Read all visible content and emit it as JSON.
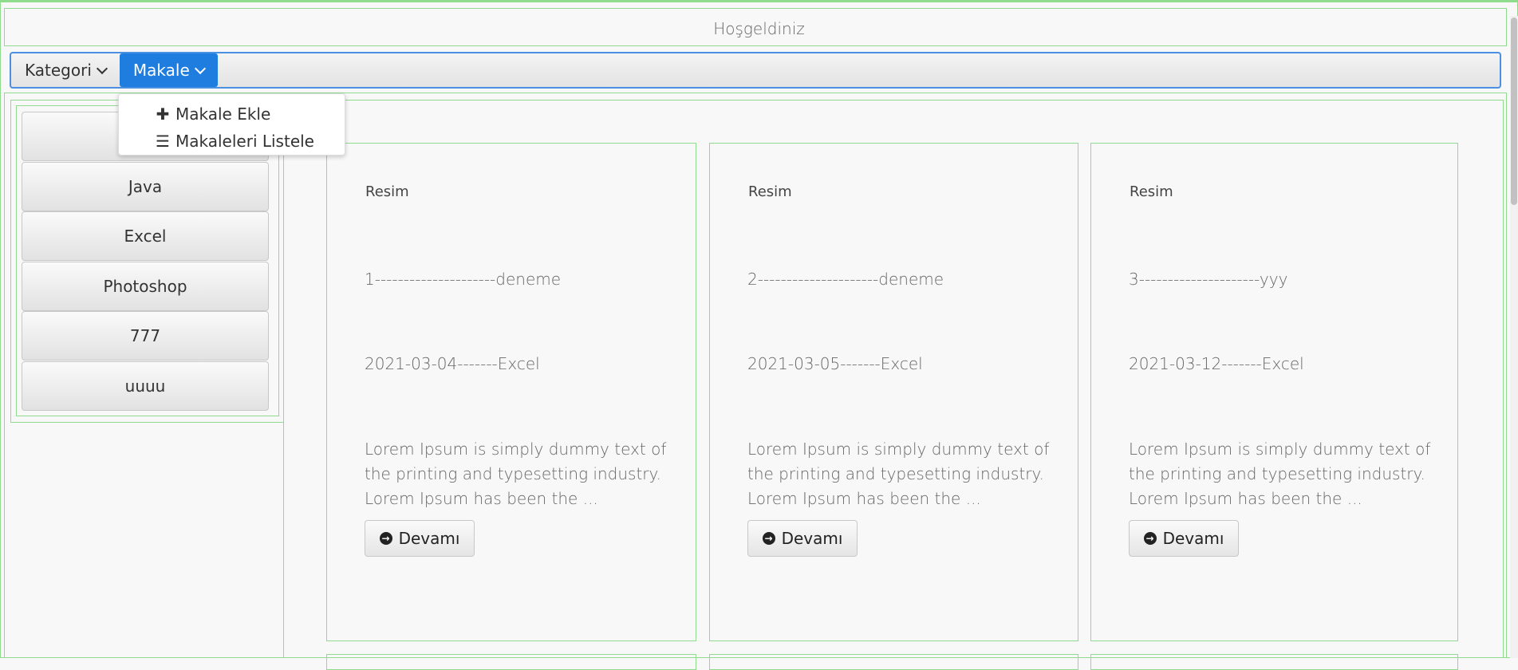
{
  "header": {
    "title": "Hoşgeldiniz"
  },
  "menubar": {
    "items": [
      {
        "label": "Kategori"
      },
      {
        "label": "Makale"
      }
    ]
  },
  "dropdown": {
    "items": [
      {
        "label": "Makale Ekle",
        "icon": "plus-icon"
      },
      {
        "label": "Makaleleri Listele",
        "icon": "list-icon"
      }
    ]
  },
  "sidebar": {
    "categories": [
      "",
      "Java",
      "Excel",
      "Photoshop",
      "777",
      "uuuu"
    ]
  },
  "articles": [
    {
      "image_label": "Resim",
      "title": "1---------------------deneme",
      "meta": "2021-03-04-------Excel",
      "excerpt": "Lorem Ipsum is simply dummy text of the printing and typesetting industry. Lorem Ipsum has been the ...",
      "button": "Devamı"
    },
    {
      "image_label": "Resim",
      "title": "2---------------------deneme",
      "meta": "2021-03-05-------Excel",
      "excerpt": "Lorem Ipsum is simply dummy text of the printing and typesetting industry. Lorem Ipsum has been the ...",
      "button": "Devamı"
    },
    {
      "image_label": "Resim",
      "title": "3---------------------yyy",
      "meta": "2021-03-12-------Excel",
      "excerpt": "Lorem Ipsum is simply dummy text of the printing and typesetting industry. Lorem Ipsum has been the ...",
      "button": "Devamı"
    }
  ],
  "colors": {
    "accent": "#1f7de0",
    "frame": "#8fdc8f"
  }
}
